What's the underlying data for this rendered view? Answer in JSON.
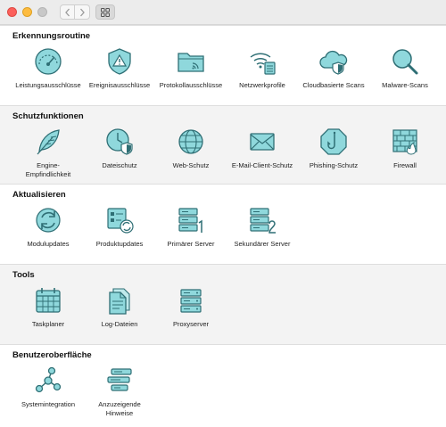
{
  "window": {
    "controls": [
      "close",
      "minimize",
      "zoom"
    ]
  },
  "toolbar": {
    "back_icon": "chevron-left-icon",
    "forward_icon": "chevron-right-icon",
    "view_icon": "grid-view-icon"
  },
  "colors": {
    "icon_fill": "#5fc3c8",
    "icon_stroke": "#2f6f75",
    "section_alt_bg": "#f3f3f3"
  },
  "sections": [
    {
      "title": "Erkennungsroutine",
      "items": [
        {
          "label": "Leistungsausschlüsse",
          "icon": "gauge-icon"
        },
        {
          "label": "Ereignisausschlüsse",
          "icon": "warning-shield-icon"
        },
        {
          "label": "Protokollausschlüsse",
          "icon": "folder-signal-icon"
        },
        {
          "label": "Netzwerkprofile",
          "icon": "wifi-list-icon"
        },
        {
          "label": "Cloudbasierte Scans",
          "icon": "cloud-shield-icon"
        },
        {
          "label": "Malware-Scans",
          "icon": "magnifier-icon"
        }
      ]
    },
    {
      "title": "Schutzfunktionen",
      "items": [
        {
          "label": "Engine-Empfindlichkeit",
          "icon": "feather-icon"
        },
        {
          "label": "Dateischutz",
          "icon": "clock-shield-icon"
        },
        {
          "label": "Web-Schutz",
          "icon": "globe-icon"
        },
        {
          "label": "E-Mail-Client-Schutz",
          "icon": "envelope-icon"
        },
        {
          "label": "Phishing-Schutz",
          "icon": "hook-octagon-icon"
        },
        {
          "label": "Firewall",
          "icon": "brick-wall-icon"
        }
      ]
    },
    {
      "title": "Aktualisieren",
      "items": [
        {
          "label": "Modulupdates",
          "icon": "refresh-icon"
        },
        {
          "label": "Produktupdates",
          "icon": "product-update-icon"
        },
        {
          "label": "Primärer Server",
          "icon": "server-1-icon"
        },
        {
          "label": "Sekundärer Server",
          "icon": "server-2-icon"
        }
      ]
    },
    {
      "title": "Tools",
      "items": [
        {
          "label": "Taskplaner",
          "icon": "calendar-icon"
        },
        {
          "label": "Log-Dateien",
          "icon": "documents-icon"
        },
        {
          "label": "Proxyserver",
          "icon": "server-icon"
        }
      ]
    },
    {
      "title": "Benutzeroberfläche",
      "items": [
        {
          "label": "Systemintegration",
          "icon": "network-nodes-icon"
        },
        {
          "label": "Anzuzeigende Hinweise",
          "icon": "notification-bars-icon"
        }
      ]
    }
  ]
}
